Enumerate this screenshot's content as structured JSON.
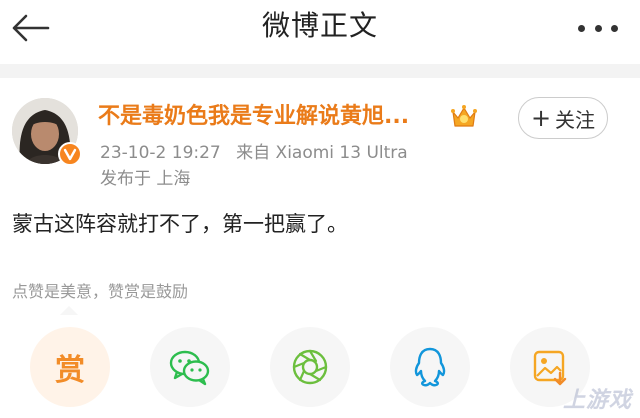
{
  "header": {
    "title": "微博正文",
    "back_icon": "arrow-left-icon",
    "more_icon": "more-dots-icon"
  },
  "post": {
    "author": {
      "name": "不是毒奶色我是专业解说黄旭...",
      "verified_icon": "verified-v-icon",
      "badge_icon": "crown-icon",
      "name_color": "#ea7b19"
    },
    "follow_button": {
      "plus": "+",
      "label": "关注"
    },
    "meta": {
      "time": "23-10-2 19:27",
      "source": "来自 Xiaomi 13 Ultra",
      "location": "发布于 上海"
    },
    "content": "蒙古这阵容就打不了，第一把赢了。",
    "reward_note": "点赞是美意，赞赏是鼓励"
  },
  "share_actions": {
    "reward_label": "赏",
    "items": [
      {
        "name": "reward",
        "icon": "reward-icon"
      },
      {
        "name": "wechat",
        "icon": "wechat-icon"
      },
      {
        "name": "moments",
        "icon": "wechat-moments-icon"
      },
      {
        "name": "qq",
        "icon": "qq-icon"
      },
      {
        "name": "save-image",
        "icon": "save-image-icon"
      }
    ]
  },
  "watermark": {
    "text": "上游戏"
  },
  "colors": {
    "accent": "#f28c28",
    "wechat": "#2dbd4e",
    "qq": "#1296db",
    "moments": "#6cbf3e"
  }
}
